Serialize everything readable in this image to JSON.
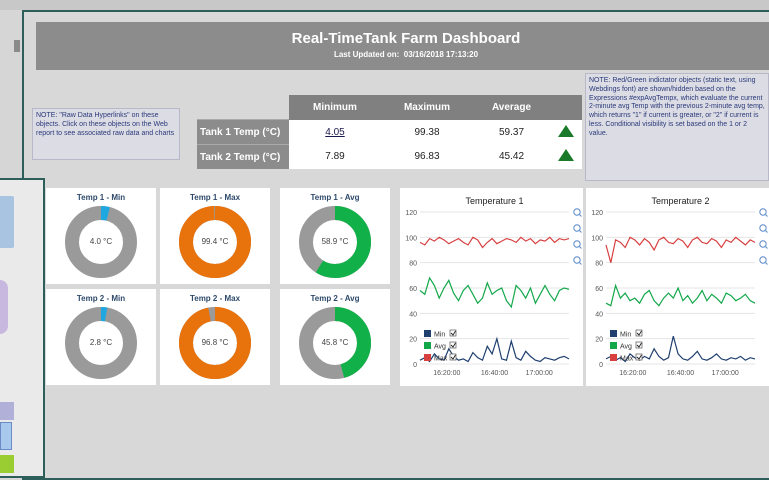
{
  "header": {
    "title": "Real-TimeTank Farm Dashboard",
    "updated_label": "Last Updated on:",
    "updated_value": "03/16/2018 17:13:20"
  },
  "note_left": "NOTE: \"Raw Data Hyperlinks\" on these objects. Click on these objects on the Web report to see associated raw data and charts",
  "note_right": "NOTE: Red/Green indictator objects (static text, using Webdings font) are shown/hidden based on the Expressions #expAvgTempx, which evaluate the current 2-minute avg Temp with the previous 2-minute avg temp, which returns \"1\" if current is greater, or \"2\" if current is less. Conditional visibility is set based on the 1 or 2 value.",
  "table": {
    "headers": [
      "Minimum",
      "Maximum",
      "Average"
    ],
    "rows": [
      {
        "label": "Tank 1 Temp (°C)",
        "min": "4.05",
        "max": "99.38",
        "avg": "59.37",
        "trend": "up"
      },
      {
        "label": "Tank 2 Temp (°C)",
        "min": "7.89",
        "max": "96.83",
        "avg": "45.42",
        "trend": "up"
      }
    ],
    "colors": {
      "up": "#1a7a2a"
    }
  },
  "gauges": [
    {
      "title": "Temp 1 - Min",
      "label": "4.0 °C",
      "fraction": 0.04,
      "color": "#1ea7e0"
    },
    {
      "title": "Temp 1 - Max",
      "label": "99.4 °C",
      "fraction": 0.994,
      "color": "#e8720c"
    },
    {
      "title": "Temp 1 - Avg",
      "label": "58.9 °C",
      "fraction": 0.589,
      "color": "#12b048"
    },
    {
      "title": "Temp 2 - Min",
      "label": "2.8 °C",
      "fraction": 0.028,
      "color": "#1ea7e0"
    },
    {
      "title": "Temp 2 - Max",
      "label": "96.8 °C",
      "fraction": 0.968,
      "color": "#e8720c"
    },
    {
      "title": "Temp 2 - Avg",
      "label": "45.8 °C",
      "fraction": 0.458,
      "color": "#12b048"
    }
  ],
  "chart_data": [
    {
      "type": "line",
      "title": "Temperature 1",
      "ylim": [
        0,
        120
      ],
      "yticks": [
        "0",
        "20",
        "40",
        "60",
        "80",
        "100",
        "120"
      ],
      "xticks": [
        "16:20:00",
        "16:40:00",
        "17:00:00"
      ],
      "xlabel": "",
      "ylabel": "",
      "series": [
        {
          "name": "Min",
          "color": "#1f3f6f",
          "values": [
            3,
            5,
            2,
            8,
            4,
            3,
            12,
            6,
            3,
            4,
            2,
            9,
            5,
            3,
            14,
            8,
            20,
            4,
            3,
            18,
            5,
            3,
            10,
            6,
            3,
            2,
            5,
            4,
            3,
            5,
            6,
            4
          ]
        },
        {
          "name": "Avg",
          "color": "#12a84a",
          "values": [
            58,
            55,
            68,
            62,
            52,
            60,
            66,
            56,
            50,
            58,
            62,
            55,
            48,
            52,
            64,
            55,
            58,
            60,
            50,
            45,
            62,
            58,
            52,
            60,
            48,
            55,
            62,
            55,
            50,
            58,
            60,
            59
          ]
        },
        {
          "name": "Max",
          "color": "#d84040",
          "values": [
            96,
            94,
            99,
            97,
            100,
            98,
            95,
            97,
            99,
            96,
            94,
            100,
            98,
            92,
            96,
            99,
            95,
            97,
            99,
            98,
            96,
            100,
            97,
            99,
            95,
            98,
            97,
            100,
            96,
            99,
            98,
            99
          ]
        }
      ],
      "legend": "bottom-left"
    },
    {
      "type": "line",
      "title": "Temperature 2",
      "ylim": [
        0,
        120
      ],
      "yticks": [
        "0",
        "20",
        "40",
        "60",
        "80",
        "100",
        "120"
      ],
      "xticks": [
        "16:20:00",
        "16:40:00",
        "17:00:00"
      ],
      "xlabel": "",
      "ylabel": "",
      "series": [
        {
          "name": "Min",
          "color": "#1f3f6f",
          "values": [
            4,
            6,
            3,
            5,
            2,
            8,
            5,
            3,
            6,
            4,
            12,
            6,
            3,
            5,
            22,
            8,
            4,
            3,
            6,
            10,
            4,
            3,
            5,
            8,
            4,
            3,
            5,
            4,
            6,
            3,
            5,
            4
          ]
        },
        {
          "name": "Avg",
          "color": "#12a84a",
          "values": [
            48,
            46,
            62,
            52,
            56,
            50,
            52,
            48,
            55,
            58,
            50,
            46,
            52,
            56,
            52,
            60,
            50,
            54,
            48,
            52,
            58,
            50,
            55,
            52,
            48,
            56,
            54,
            50,
            52,
            55,
            50,
            48
          ]
        },
        {
          "name": "Max",
          "color": "#d84040",
          "values": [
            94,
            80,
            98,
            96,
            92,
            100,
            98,
            94,
            99,
            96,
            90,
            98,
            100,
            96,
            95,
            99,
            97,
            92,
            98,
            100,
            96,
            95,
            99,
            97,
            92,
            98,
            96,
            100,
            97,
            94,
            98,
            96
          ]
        }
      ],
      "legend": "bottom-left"
    }
  ]
}
